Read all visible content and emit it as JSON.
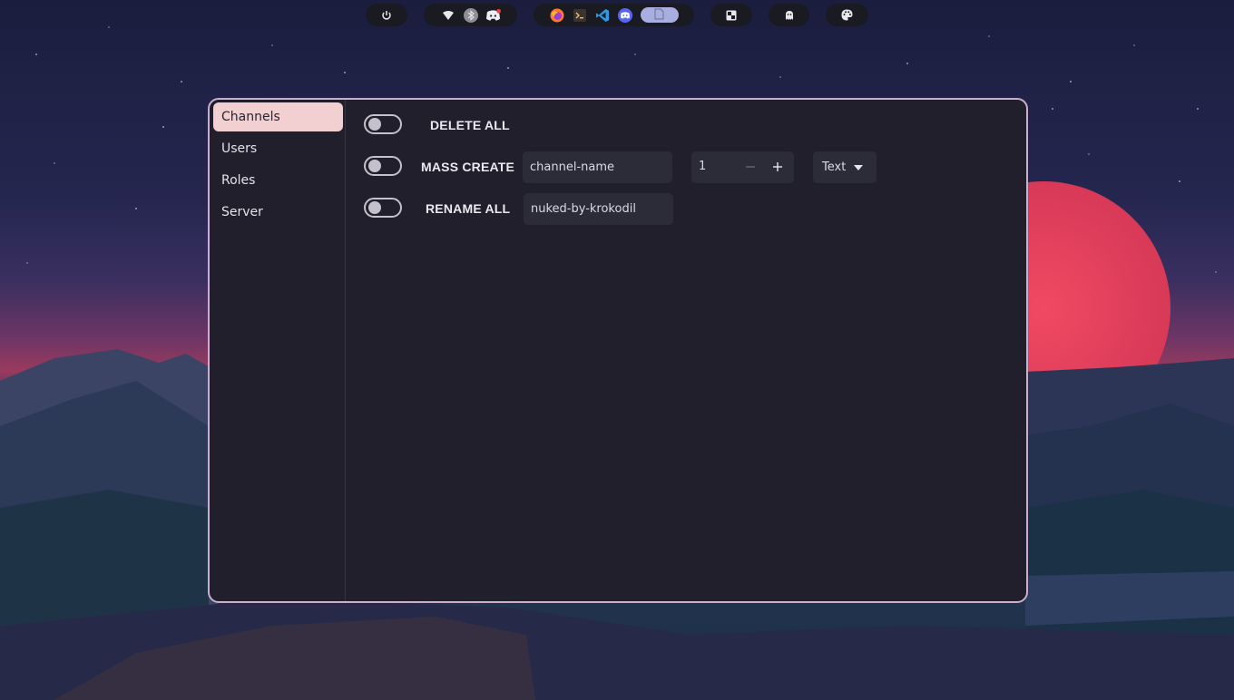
{
  "topbar": {
    "icons": [
      "power-icon",
      "wifi-icon",
      "bluetooth-icon",
      "discord-icon",
      "firefox-icon",
      "terminal-icon",
      "vscode-icon",
      "discord-icon",
      "file-icon",
      "checker-icon",
      "ghost-icon",
      "palette-icon"
    ]
  },
  "sidebar": {
    "items": [
      {
        "label": "Channels"
      },
      {
        "label": "Users"
      },
      {
        "label": "Roles"
      },
      {
        "label": "Server"
      }
    ]
  },
  "actions": {
    "delete_all": {
      "label": "DELETE ALL",
      "enabled": false
    },
    "mass_create": {
      "label": "MASS CREATE",
      "enabled": false,
      "name_value": "channel-name",
      "count": "1",
      "type": "Text"
    },
    "rename_all": {
      "label": "RENAME ALL",
      "enabled": false,
      "name_value": "nuked-by-krokodil"
    }
  },
  "colors": {
    "accent": "#f2cfd0",
    "window_bg": "#201f2b",
    "window_border": "#c9aed0",
    "field_bg": "#2c2b38"
  }
}
